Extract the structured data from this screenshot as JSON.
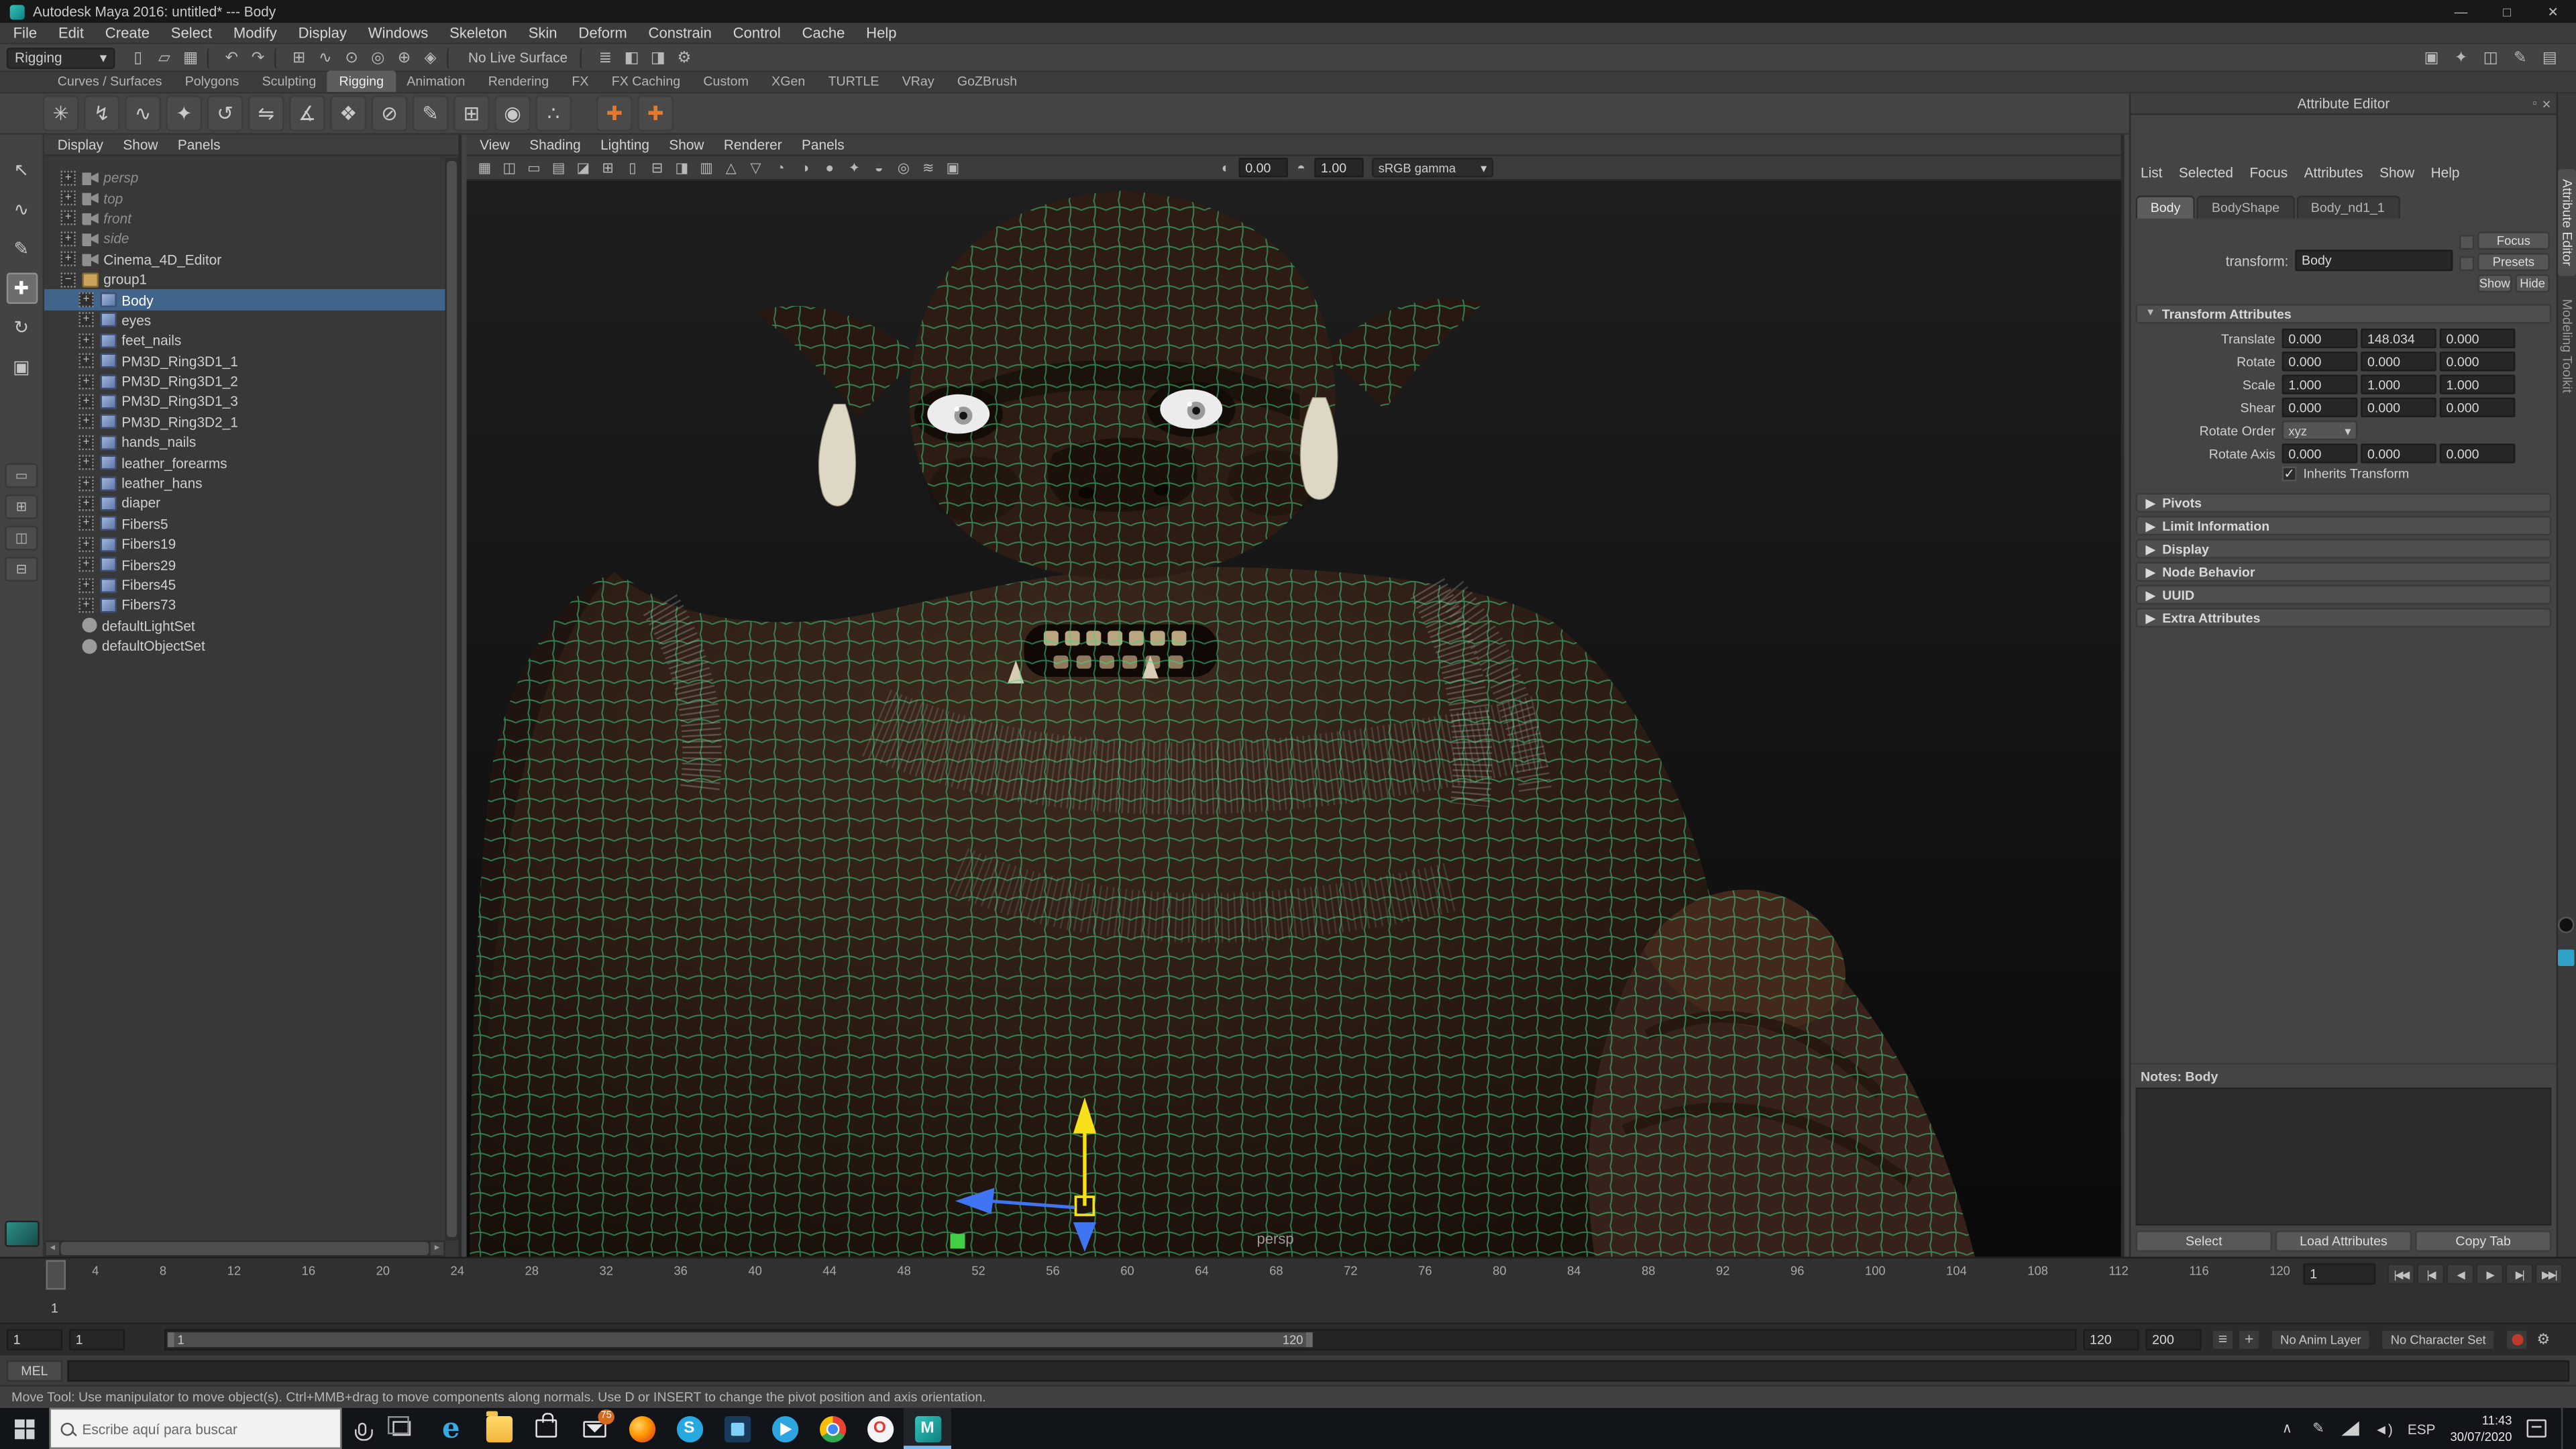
{
  "colors": {
    "selection_blue": "#41658a",
    "wireframe_green": "#3fd584",
    "shelf_accent_orange": "#e2792e",
    "maya_teal": "#19a6a3",
    "badge_orange": "#d86a1f",
    "taskbar_accent_blue": "#76b9ed",
    "autokey_red": "#c0392b"
  },
  "window": {
    "title": "Autodesk Maya 2016: untitled* --- Body",
    "minimize": "—",
    "maximize": "□",
    "close": "✕"
  },
  "menubar": {
    "items": [
      "File",
      "Edit",
      "Create",
      "Select",
      "Modify",
      "Display",
      "Windows",
      "Skeleton",
      "Skin",
      "Deform",
      "Constrain",
      "Control",
      "Cache",
      "Help"
    ]
  },
  "statusline": {
    "menuset": "Rigging",
    "dropdown_arrow": "▾",
    "icons_a": [
      {
        "name": "new-scene-icon",
        "glyph": "▯"
      },
      {
        "name": "open-scene-icon",
        "glyph": "▱"
      },
      {
        "name": "save-scene-icon",
        "glyph": "▦"
      },
      {
        "name": "separator",
        "glyph": "",
        "cls": "sep"
      },
      {
        "name": "undo-icon",
        "glyph": "↶"
      },
      {
        "name": "redo-icon",
        "glyph": "↷"
      },
      {
        "name": "separator",
        "glyph": "",
        "cls": "sep"
      },
      {
        "name": "snap-to-grid-icon",
        "glyph": "⊞"
      },
      {
        "name": "snap-to-curve-icon",
        "glyph": "∿"
      },
      {
        "name": "snap-to-point-icon",
        "glyph": "⊙"
      },
      {
        "name": "snap-to-projected-center-icon",
        "glyph": "◎"
      },
      {
        "name": "snap-to-view-plane-icon",
        "glyph": "⊕"
      },
      {
        "name": "make-live-icon",
        "glyph": "◈"
      },
      {
        "name": "separator",
        "glyph": "",
        "cls": "sep"
      }
    ],
    "live_surface": "No Live Surface",
    "icons_b": [
      {
        "name": "separator",
        "glyph": "",
        "cls": "sep"
      },
      {
        "name": "construction-history-icon",
        "glyph": "≣"
      },
      {
        "name": "render-current-frame-icon",
        "glyph": "◧"
      },
      {
        "name": "ipr-render-icon",
        "glyph": "◨"
      },
      {
        "name": "render-settings-icon",
        "glyph": "⚙"
      }
    ],
    "toggles": [
      {
        "name": "modeling-toolkit-toggle",
        "glyph": "▣"
      },
      {
        "name": "humanik-toggle",
        "glyph": "✦"
      },
      {
        "name": "attribute-editor-toggle",
        "glyph": "◫"
      },
      {
        "name": "tool-settings-toggle",
        "glyph": "✎"
      },
      {
        "name": "channel-box-toggle",
        "glyph": "▤"
      }
    ]
  },
  "shelf": {
    "tabs": [
      {
        "label": "Curves / Surfaces"
      },
      {
        "label": "Polygons"
      },
      {
        "label": "Sculpting"
      },
      {
        "label": "Rigging",
        "cls": "active"
      },
      {
        "label": "Animation"
      },
      {
        "label": "Rendering"
      },
      {
        "label": "FX"
      },
      {
        "label": "FX Caching"
      },
      {
        "label": "Custom"
      },
      {
        "label": "XGen"
      },
      {
        "label": "TURTLE"
      },
      {
        "label": "VRay"
      },
      {
        "label": "GoZBrush"
      }
    ],
    "icons": [
      {
        "name": "create-joint-icon",
        "glyph": "✳"
      },
      {
        "name": "create-ik-handle-icon",
        "glyph": "↯"
      },
      {
        "name": "ik-spline-handle-icon",
        "glyph": "∿"
      },
      {
        "name": "insert-joint-icon",
        "glyph": "✦"
      },
      {
        "name": "reroot-skeleton-icon",
        "glyph": "↺"
      },
      {
        "name": "mirror-joint-icon",
        "glyph": "⇋"
      },
      {
        "name": "orient-joint-icon",
        "glyph": "∡"
      },
      {
        "name": "bind-skin-icon",
        "glyph": "❖"
      },
      {
        "name": "unbind-skin-icon",
        "glyph": "⊘"
      },
      {
        "name": "paint-skin-weights-icon",
        "glyph": "✎"
      },
      {
        "name": "lattice-deformer-icon",
        "glyph": "⊞"
      },
      {
        "name": "wrap-deformer-icon",
        "glyph": "◉"
      },
      {
        "name": "cluster-deformer-icon",
        "glyph": "∴"
      },
      {
        "name": "create-control-icon",
        "glyph": "✚",
        "cls": "orange gap"
      },
      {
        "name": "create-control-curve-icon",
        "glyph": "✚",
        "cls": "orange"
      }
    ],
    "side_icons": [
      {
        "name": "shelf-tab-menu-icon",
        "glyph": "▾"
      },
      {
        "name": "shelf-options-gear-icon",
        "glyph": "⚙"
      }
    ]
  },
  "toolbox": {
    "tools": [
      {
        "name": "select-tool",
        "glyph": "↖"
      },
      {
        "name": "lasso-select-tool",
        "glyph": "∿"
      },
      {
        "name": "paint-select-tool",
        "glyph": "✎"
      },
      {
        "name": "move-tool",
        "glyph": "✚",
        "cls": "active"
      },
      {
        "name": "rotate-tool",
        "glyph": "↻"
      },
      {
        "name": "scale-tool",
        "glyph": "▣"
      }
    ],
    "layouts": [
      {
        "name": "layout-single-pane",
        "glyph": "▭"
      },
      {
        "name": "layout-four-pane",
        "glyph": "⊞"
      },
      {
        "name": "layout-two-pane-side",
        "glyph": "◫"
      },
      {
        "name": "layout-two-pane-stacked",
        "glyph": "⊟"
      }
    ]
  },
  "outliner": {
    "menus": [
      "Display",
      "Show",
      "Panels"
    ],
    "items": [
      {
        "label": "persp",
        "icon": "camera",
        "expander": "+",
        "indent": 0,
        "cls": "grayed"
      },
      {
        "label": "top",
        "icon": "camera",
        "expander": "+",
        "indent": 0,
        "cls": "grayed"
      },
      {
        "label": "front",
        "icon": "camera",
        "expander": "+",
        "indent": 0,
        "cls": "grayed"
      },
      {
        "label": "side",
        "icon": "camera",
        "expander": "+",
        "indent": 0,
        "cls": "grayed"
      },
      {
        "label": "Cinema_4D_Editor",
        "icon": "camera",
        "expander": "+",
        "indent": 0,
        "cls": ""
      },
      {
        "label": "group1",
        "icon": "group",
        "expander": "−",
        "indent": 0,
        "cls": ""
      },
      {
        "label": "Body",
        "icon": "mesh",
        "expander": "+",
        "indent": 1,
        "cls": "selected"
      },
      {
        "label": "eyes",
        "icon": "mesh",
        "expander": "+",
        "indent": 1,
        "cls": ""
      },
      {
        "label": "feet_nails",
        "icon": "mesh",
        "expander": "+",
        "indent": 1,
        "cls": ""
      },
      {
        "label": "PM3D_Ring3D1_1",
        "icon": "mesh",
        "expander": "+",
        "indent": 1,
        "cls": ""
      },
      {
        "label": "PM3D_Ring3D1_2",
        "icon": "mesh",
        "expander": "+",
        "indent": 1,
        "cls": ""
      },
      {
        "label": "PM3D_Ring3D1_3",
        "icon": "mesh",
        "expander": "+",
        "indent": 1,
        "cls": ""
      },
      {
        "label": "PM3D_Ring3D2_1",
        "icon": "mesh",
        "expander": "+",
        "indent": 1,
        "cls": ""
      },
      {
        "label": "hands_nails",
        "icon": "mesh",
        "expander": "+",
        "indent": 1,
        "cls": ""
      },
      {
        "label": "leather_forearms",
        "icon": "mesh",
        "expander": "+",
        "indent": 1,
        "cls": ""
      },
      {
        "label": "leather_hans",
        "icon": "mesh",
        "expander": "+",
        "indent": 1,
        "cls": ""
      },
      {
        "label": "diaper",
        "icon": "mesh",
        "expander": "+",
        "indent": 1,
        "cls": ""
      },
      {
        "label": "Fibers5",
        "icon": "mesh",
        "expander": "+",
        "indent": 1,
        "cls": ""
      },
      {
        "label": "Fibers19",
        "icon": "mesh",
        "expander": "+",
        "indent": 1,
        "cls": ""
      },
      {
        "label": "Fibers29",
        "icon": "mesh",
        "expander": "+",
        "indent": 1,
        "cls": ""
      },
      {
        "label": "Fibers45",
        "icon": "mesh",
        "expander": "+",
        "indent": 1,
        "cls": ""
      },
      {
        "label": "Fibers73",
        "icon": "mesh",
        "expander": "+",
        "indent": 1,
        "cls": ""
      },
      {
        "label": "defaultLightSet",
        "icon": "set",
        "expander": "",
        "indent": 0,
        "cls": ""
      },
      {
        "label": "defaultObjectSet",
        "icon": "set",
        "expander": "",
        "indent": 0,
        "cls": ""
      }
    ]
  },
  "viewport": {
    "menus": [
      "View",
      "Shading",
      "Lighting",
      "Show",
      "Renderer",
      "Panels"
    ],
    "toolbar_icons": [
      {
        "name": "select-camera-icon",
        "glyph": "▦"
      },
      {
        "name": "lock-camera-icon",
        "glyph": "◫"
      },
      {
        "name": "camera-attributes-icon",
        "glyph": "▭"
      },
      {
        "name": "bookmarks-icon",
        "glyph": "▤"
      },
      {
        "name": "image-plane-icon",
        "glyph": "◪"
      },
      {
        "name": "two-d-pan-zoom-icon",
        "glyph": "⊞"
      },
      {
        "name": "film-gate-icon",
        "glyph": "▯"
      },
      {
        "name": "resolution-gate-icon",
        "glyph": "⊟"
      },
      {
        "name": "gate-mask-icon",
        "glyph": "◨"
      },
      {
        "name": "field-chart-icon",
        "glyph": "▥"
      },
      {
        "name": "safe-action-icon",
        "glyph": "△"
      },
      {
        "name": "safe-title-icon",
        "glyph": "▽"
      },
      {
        "name": "wireframe-icon",
        "glyph": "◔"
      },
      {
        "name": "shaded-icon",
        "glyph": "◑"
      },
      {
        "name": "textured-icon",
        "glyph": "●"
      },
      {
        "name": "use-all-lights-icon",
        "glyph": "✦"
      },
      {
        "name": "shadows-icon",
        "glyph": "◒"
      },
      {
        "name": "screen-space-ao-icon",
        "glyph": "◎"
      },
      {
        "name": "motion-blur-icon",
        "glyph": "≋"
      },
      {
        "name": "multisample-aa-icon",
        "glyph": "▣"
      }
    ],
    "exposure_icon": "◐",
    "exposure": "0.00",
    "gamma_icon": "◓",
    "gamma": "1.00",
    "gamma_mode": "sRGB gamma",
    "dropdown_arrow": "▾",
    "camera_label": "persp"
  },
  "attribute_editor": {
    "panel_title": "Attribute Editor",
    "menus": [
      "List",
      "Selected",
      "Focus",
      "Attributes",
      "Show",
      "Help"
    ],
    "tabs": [
      {
        "label": "Body",
        "cls": "active"
      },
      {
        "label": "BodyShape"
      },
      {
        "label": "Body_nd1_1"
      }
    ],
    "transform_label": "transform:",
    "transform_value": "Body",
    "focus_button": "Focus",
    "presets_button": "Presets",
    "show_button": "Show",
    "hide_button": "Hide",
    "transform_attributes": {
      "title": "Transform Attributes",
      "translate": {
        "label": "Translate",
        "x": "0.000",
        "y": "148.034",
        "z": "0.000"
      },
      "rotate": {
        "label": "Rotate",
        "x": "0.000",
        "y": "0.000",
        "z": "0.000"
      },
      "scale": {
        "label": "Scale",
        "x": "1.000",
        "y": "1.000",
        "z": "1.000"
      },
      "shear": {
        "label": "Shear",
        "x": "0.000",
        "y": "0.000",
        "z": "0.000"
      },
      "rotate_order_label": "Rotate Order",
      "rotate_order_value": "xyz",
      "rotate_axis": {
        "label": "Rotate Axis",
        "x": "0.000",
        "y": "0.000",
        "z": "0.000"
      },
      "inherits_transform_label": "Inherits Transform",
      "inherits_checked": "✓"
    },
    "collapsed_sections": [
      "Pivots",
      "Limit Information",
      "Display",
      "Node Behavior",
      "UUID",
      "Extra Attributes"
    ],
    "notes_label": "Notes: Body",
    "footer_buttons": [
      "Select",
      "Load Attributes",
      "Copy Tab"
    ],
    "side_tabs": [
      {
        "label": "Attribute Editor",
        "cls": "active"
      },
      {
        "label": "Modeling Toolkit"
      }
    ]
  },
  "timeslider": {
    "ticks": [
      4,
      8,
      12,
      16,
      20,
      24,
      28,
      32,
      36,
      40,
      44,
      48,
      52,
      56,
      60,
      64,
      68,
      72,
      76,
      80,
      84,
      88,
      92,
      96,
      100,
      104,
      108,
      112,
      116,
      120
    ],
    "playhead_label": "1",
    "current_frame": "1",
    "playback": [
      {
        "name": "go-to-start-button",
        "glyph": "|◀◀"
      },
      {
        "name": "step-back-button",
        "glyph": "|◀"
      },
      {
        "name": "play-backwards-button",
        "glyph": "◀"
      },
      {
        "name": "play-forwards-button",
        "glyph": "▶"
      },
      {
        "name": "step-forward-button",
        "glyph": "▶|"
      },
      {
        "name": "go-to-end-button",
        "glyph": "▶▶|"
      }
    ]
  },
  "rangeslider": {
    "anim_start": "1",
    "play_start": "1",
    "bar_start": "1",
    "bar_end": "120",
    "play_end": "120",
    "anim_end": "200",
    "icons": [
      {
        "name": "playback-speed-icon",
        "glyph": "≡"
      },
      {
        "name": "add-keyframe-icon",
        "glyph": "+"
      }
    ],
    "anim_layer": "No Anim Layer",
    "character_set": "No Character Set",
    "prefs_gear": "⚙"
  },
  "command_line": {
    "mode": "MEL"
  },
  "helpline": {
    "text": "Move Tool: Use manipulator to move object(s). Ctrl+MMB+drag to move components along normals. Use D or INSERT to change the pivot position and axis orientation."
  },
  "taskbar": {
    "search_placeholder": "Escribe aquí para buscar",
    "apps": [
      {
        "name": "edge",
        "badge": ""
      },
      {
        "name": "file-explorer",
        "badge": ""
      },
      {
        "name": "store",
        "badge": ""
      },
      {
        "name": "mail",
        "badge": "75"
      },
      {
        "name": "firefox",
        "badge": ""
      },
      {
        "name": "skype",
        "badge": ""
      },
      {
        "name": "photos",
        "badge": ""
      },
      {
        "name": "telegram",
        "badge": ""
      },
      {
        "name": "chrome",
        "badge": ""
      },
      {
        "name": "opera",
        "badge": ""
      },
      {
        "name": "maya",
        "badge": "",
        "cls": "active"
      }
    ],
    "tray": [
      {
        "name": "hidden-icons-chevron",
        "glyph": "∧"
      },
      {
        "name": "pen-input-icon",
        "glyph": "✎"
      },
      {
        "name": "volume-icon",
        "glyph": "◄)"
      },
      {
        "name": "language-indicator",
        "glyph": "ESP"
      }
    ],
    "time": "11:43",
    "date": "30/07/2020"
  }
}
